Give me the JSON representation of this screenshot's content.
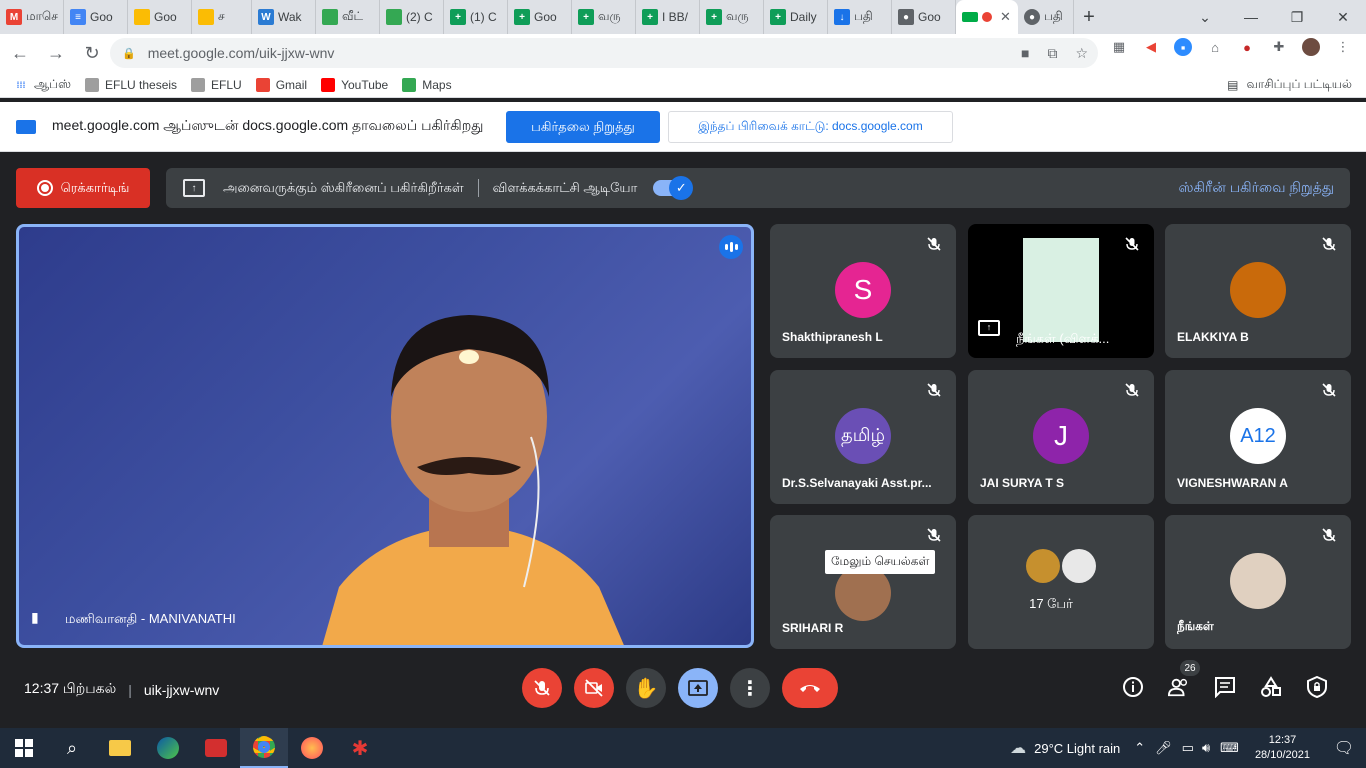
{
  "browser": {
    "tabs": [
      {
        "label": "மாசெ",
        "fav_color": "#ea4335",
        "fav_text": "M"
      },
      {
        "label": "Goo",
        "fav_color": "#4285f4",
        "fav_text": "≡"
      },
      {
        "label": "Goo",
        "fav_color": "#fbbc04",
        "fav_text": ""
      },
      {
        "label": "ச",
        "fav_color": "#fbbc04",
        "fav_text": ""
      },
      {
        "label": "Wak",
        "fav_color": "#2b7bd3",
        "fav_text": "W"
      },
      {
        "label": "வீட்",
        "fav_color": "#34a853",
        "fav_text": ""
      },
      {
        "label": "(2) C",
        "fav_color": "#34a853",
        "fav_text": ""
      },
      {
        "label": "(1) C",
        "fav_color": "#0f9d58",
        "fav_text": "+"
      },
      {
        "label": "Goo",
        "fav_color": "#0f9d58",
        "fav_text": "+"
      },
      {
        "label": "வரு",
        "fav_color": "#0f9d58",
        "fav_text": "+"
      },
      {
        "label": "I BB/",
        "fav_color": "#0f9d58",
        "fav_text": "+"
      },
      {
        "label": "வரு",
        "fav_color": "#0f9d58",
        "fav_text": "+"
      },
      {
        "label": "Daily",
        "fav_color": "#0f9d58",
        "fav_text": "+"
      },
      {
        "label": "பதி",
        "fav_color": "#1a73e8",
        "fav_text": "↓"
      },
      {
        "label": "Goo",
        "fav_color": "#5f6368",
        "fav_text": "●"
      }
    ],
    "active_tab_label": "",
    "last_tab_label": "பதி",
    "url": "meet.google.com/uik-jjxw-wnv",
    "bookmarks": [
      {
        "label": "ஆப்ஸ்",
        "color": "#4285f4"
      },
      {
        "label": "EFLU theseis",
        "color": "#9e9e9e"
      },
      {
        "label": "EFLU",
        "color": "#9e9e9e"
      },
      {
        "label": "Gmail",
        "color": "#ea4335"
      },
      {
        "label": "YouTube",
        "color": "#ff0000"
      },
      {
        "label": "Maps",
        "color": "#34a853"
      }
    ],
    "reading_list": "வாசிப்புப் பட்டியல்"
  },
  "sharebar": {
    "text": "meet.google.com ஆப்ஸுடன் docs.google.com தாவலைப் பகிர்கிறது",
    "stop_button": "பகிர்தலை நிறுத்து",
    "show_tab_button": "இந்தப் பிரிவைக் காட்டு: docs.google.com"
  },
  "meet": {
    "recording_label": "ரெக்கார்டிங்",
    "presenting_text": "அனைவருக்கும் ஸ்கிரீனைப் பகிர்கிறீர்கள்",
    "presentation_audio": "விளக்கக்காட்சி ஆடியோ",
    "stop_screen_share": "ஸ்கிரீன் பகிர்வை நிறுத்து",
    "main_speaker": "மணிவானதி - MANIVANATHI",
    "participants": [
      {
        "name": "Shakthipranesh L",
        "initial": "S",
        "color": "#e52592"
      },
      {
        "name": "நீங்கள் (விளக்...",
        "initial": "",
        "color": ""
      },
      {
        "name": "ELAKKIYA B",
        "initial": "",
        "color": "#c96a0b"
      },
      {
        "name": "Dr.S.Selvanayaki Asst.pr...",
        "initial": "தமிழ்",
        "color": "#6a4fb5"
      },
      {
        "name": "JAI SURYA T S",
        "initial": "J",
        "color": "#8e24aa"
      },
      {
        "name": "VIGNESHWARAN A",
        "initial": "A12",
        "color": "#ffffff"
      },
      {
        "name": "SRIHARI R",
        "initial": "",
        "color": "#a07050"
      },
      {
        "name": "17 பேர்",
        "initial": "",
        "color": ""
      },
      {
        "name": "நீங்கள்",
        "initial": "",
        "color": "#e0d0c0"
      }
    ],
    "more_actions_tooltip": "மேலும் செயல்கள்",
    "time": "12:37 பிற்பகல்",
    "meeting_code": "uik-jjxw-wnv",
    "people_count": "26"
  },
  "taskbar": {
    "weather": "29°C  Light rain",
    "clock_time": "12:37",
    "clock_date": "28/10/2021"
  },
  "colors": {
    "accent": "#1a73e8",
    "danger": "#ea4335",
    "meet_bg": "#202124",
    "tile_bg": "#3c4043"
  }
}
